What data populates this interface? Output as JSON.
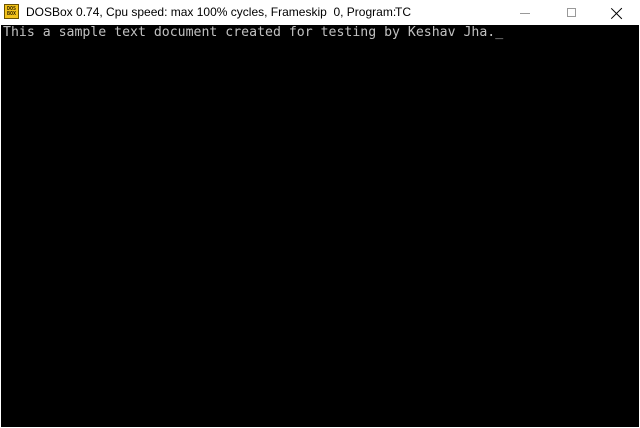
{
  "window": {
    "title": "DOSBox 0.74, Cpu speed: max 100% cycles, Frameskip  0, Program:",
    "program": "TC",
    "icon_text_top": "DOS",
    "icon_text_bottom": "BOX",
    "icon_name": "dosbox-icon"
  },
  "console": {
    "line_1": "This a sample text document created for testing by Keshav Jha.",
    "cursor": "_",
    "text_color": "#c0c0c0",
    "background_color": "#000000"
  }
}
